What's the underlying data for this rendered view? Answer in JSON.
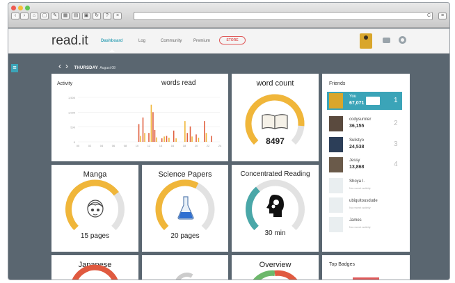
{
  "browser": {
    "toolbar_icons": [
      "back-icon",
      "forward-icon",
      "home-icon",
      "window-icon",
      "grid-icon",
      "tools-icon",
      "bookmark-icon",
      "share-icon",
      "reload-icon",
      "help-icon",
      "stop-icon"
    ],
    "url_right_text": "C"
  },
  "app": {
    "logo": "read.it",
    "nav": [
      {
        "label": "Dashboard",
        "active": true
      },
      {
        "label": "Log",
        "active": false
      },
      {
        "label": "Community",
        "active": false
      },
      {
        "label": "Premium",
        "active": false
      }
    ],
    "store_label": "STORE",
    "accent": "#3ba4b8"
  },
  "date": {
    "day": "THURSDAY",
    "date": "August 08"
  },
  "activity": {
    "label": "Activity",
    "title": "words read",
    "chart_data": {
      "type": "bar",
      "ylim": [
        0,
        1500
      ],
      "yticks": [
        "1,500",
        "1,000",
        "500",
        "0"
      ],
      "xticks": [
        "00",
        "02",
        "04",
        "06",
        "08",
        "10",
        "12",
        "14",
        "16",
        "18",
        "20",
        "22",
        "24"
      ],
      "series": [
        {
          "values": [
            0,
            0,
            0,
            0,
            0,
            0,
            0,
            0,
            0,
            0,
            0,
            0,
            0,
            0,
            0,
            0,
            0,
            0,
            0,
            0,
            0,
            0,
            0,
            0,
            0,
            0,
            0,
            0,
            0,
            0,
            0,
            0,
            0,
            0,
            0,
            0,
            0,
            0,
            0,
            0,
            0,
            0,
            0,
            0,
            0,
            0,
            0,
            0,
            0,
            0,
            0,
            0,
            0,
            0,
            0,
            0,
            0,
            0,
            0,
            0,
            0,
            0,
            0,
            0,
            0,
            0,
            0,
            0,
            0,
            0,
            0,
            0,
            0,
            0,
            0,
            0,
            0,
            0,
            0,
            0,
            0,
            0,
            0,
            0,
            0,
            0,
            0,
            0,
            0,
            0,
            0,
            0,
            0,
            0,
            0,
            0,
            0,
            0,
            0,
            0,
            0,
            0,
            0,
            0,
            0,
            0,
            0,
            0,
            0,
            0,
            0,
            0,
            0,
            0,
            0,
            0,
            0,
            0,
            0,
            0,
            0,
            0,
            0,
            0,
            0,
            0,
            0,
            0,
            0,
            0,
            0,
            0,
            0,
            0,
            0,
            0,
            0,
            0,
            0,
            0,
            0,
            0,
            0,
            0,
            0,
            0,
            0,
            0,
            0,
            0,
            0,
            0,
            0,
            0,
            0,
            0,
            0,
            0,
            0,
            0,
            0,
            0,
            0,
            0,
            0,
            0,
            0,
            0,
            0,
            0,
            0,
            0,
            0,
            0,
            0,
            0,
            0,
            0,
            0,
            0,
            0,
            0,
            0,
            0,
            0,
            0,
            0,
            0,
            0,
            0,
            0,
            0,
            0,
            0,
            0,
            0,
            0,
            0,
            0,
            0,
            0,
            0,
            0,
            0,
            0,
            0,
            0,
            0,
            0,
            0,
            0,
            0,
            0,
            0,
            0,
            0,
            0,
            0,
            0,
            0,
            0,
            0,
            0,
            0,
            0,
            0,
            0,
            0,
            0,
            0,
            0,
            0,
            0,
            0,
            0,
            0,
            0,
            0,
            0,
            0,
            0,
            0,
            0,
            0,
            0,
            0,
            0,
            0,
            0,
            0,
            0,
            0,
            0,
            0,
            0,
            0,
            0,
            0,
            0,
            0,
            0,
            0,
            0,
            0,
            0,
            0,
            0,
            0,
            0,
            0,
            0,
            0,
            0,
            0,
            0,
            0,
            0,
            0,
            0,
            0,
            0,
            0,
            0,
            0
          ]
        }
      ],
      "hour_bars": [
        {
          "hour": 10.3,
          "value": 600,
          "color": "#e06040"
        },
        {
          "hour": 10.6,
          "value": 200,
          "color": "#f0b63a"
        },
        {
          "hour": 11.0,
          "value": 820,
          "color": "#e06040"
        },
        {
          "hour": 11.3,
          "value": 300,
          "color": "#f0b63a"
        },
        {
          "hour": 12.0,
          "value": 300,
          "color": "#e06040"
        },
        {
          "hour": 12.4,
          "value": 1250,
          "color": "#f0b63a"
        },
        {
          "hour": 12.7,
          "value": 1000,
          "color": "#e06040"
        },
        {
          "hour": 13.0,
          "value": 400,
          "color": "#e06040"
        },
        {
          "hour": 13.3,
          "value": 150,
          "color": "#f0b63a"
        },
        {
          "hour": 14.2,
          "value": 120,
          "color": "#e06040"
        },
        {
          "hour": 14.6,
          "value": 180,
          "color": "#f0b63a"
        },
        {
          "hour": 15.0,
          "value": 200,
          "color": "#e06040"
        },
        {
          "hour": 15.4,
          "value": 140,
          "color": "#f0b63a"
        },
        {
          "hour": 16.2,
          "value": 380,
          "color": "#e06040"
        },
        {
          "hour": 16.6,
          "value": 120,
          "color": "#f0b63a"
        },
        {
          "hour": 18.1,
          "value": 700,
          "color": "#f0b63a"
        },
        {
          "hour": 18.5,
          "value": 300,
          "color": "#e06040"
        },
        {
          "hour": 19.0,
          "value": 520,
          "color": "#e06040"
        },
        {
          "hour": 19.3,
          "value": 180,
          "color": "#f0b63a"
        },
        {
          "hour": 20.0,
          "value": 250,
          "color": "#e06040"
        },
        {
          "hour": 20.4,
          "value": 140,
          "color": "#f0b63a"
        },
        {
          "hour": 21.4,
          "value": 700,
          "color": "#e06040"
        },
        {
          "hour": 21.7,
          "value": 300,
          "color": "#f0b63a"
        },
        {
          "hour": 22.6,
          "value": 200,
          "color": "#e06040"
        }
      ]
    }
  },
  "word_count": {
    "title": "word count",
    "value": "8497",
    "level": 0.85
  },
  "gauges": [
    {
      "key": "manga",
      "title": "Manga",
      "caption": "15 pages",
      "level": 0.7,
      "color": "#f0b63a",
      "icon": "manga-face-icon"
    },
    {
      "key": "science",
      "title": "Science Papers",
      "caption": "20 pages",
      "level": 0.6,
      "color": "#f0b63a",
      "icon": "flask-icon"
    },
    {
      "key": "reading",
      "title": "Concentrated Reading",
      "caption": "30 min",
      "level": 0.35,
      "color": "#4aa7a8",
      "icon": "brain-head-icon"
    }
  ],
  "bottom_cards": [
    {
      "key": "japanese",
      "title": "Japanese",
      "color": "#e05a40"
    },
    {
      "key": "untitled",
      "title": "",
      "color": "#cccccc"
    },
    {
      "key": "overview",
      "title": "Overview",
      "color": "#6db86b"
    }
  ],
  "friends": {
    "title": "Friends",
    "items": [
      {
        "name": "You",
        "score": "67,071",
        "rank": "1",
        "highlight": true
      },
      {
        "name": "codysurnter",
        "score": "36,155",
        "rank": "2",
        "highlight": false
      },
      {
        "name": "Sulistyo",
        "score": "24,538",
        "rank": "3",
        "highlight": false
      },
      {
        "name": "Jessy",
        "score": "13,868",
        "rank": "4",
        "highlight": false
      },
      {
        "name": "Shoya I.",
        "note": "No recent activity",
        "highlight": false
      },
      {
        "name": "ubiquitousdude",
        "note": "No recent activity",
        "highlight": false
      },
      {
        "name": "James",
        "note": "No recent activity",
        "highlight": false
      }
    ]
  },
  "top_badges": {
    "title": "Top Badges"
  }
}
